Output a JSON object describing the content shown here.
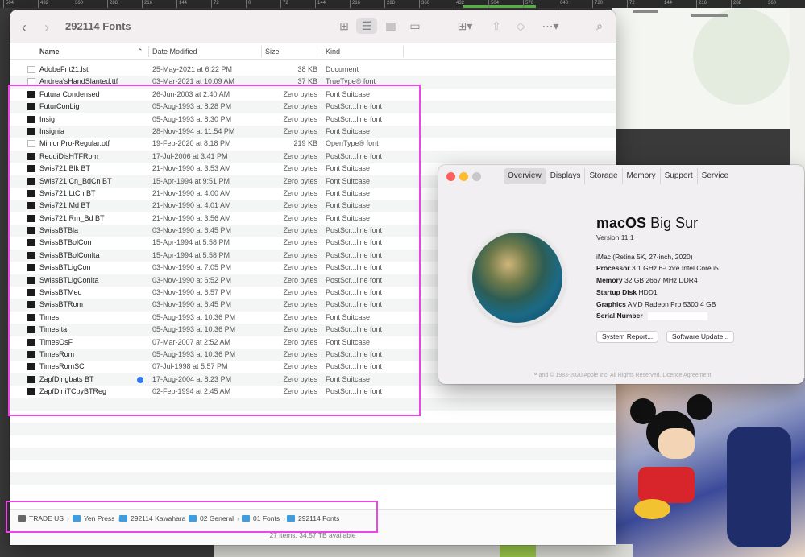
{
  "ruler": {
    "labels": [
      "504",
      "432",
      "360",
      "288",
      "216",
      "144",
      "72",
      "0",
      "72",
      "144",
      "216",
      "288",
      "360",
      "432",
      "504",
      "576",
      "648",
      "720",
      "72",
      "144",
      "216",
      "288",
      "360"
    ]
  },
  "finder": {
    "title": "292114 Fonts",
    "columns": {
      "name": "Name",
      "date": "Date Modified",
      "size": "Size",
      "kind": "Kind"
    },
    "files": [
      {
        "name": "AdobeFnt21.lst",
        "date": "25-May-2021 at 6:22 PM",
        "size": "38 KB",
        "kind": "Document",
        "icon": "document-icon"
      },
      {
        "name": "Andrea'sHandSlanted.ttf",
        "date": "03-Mar-2021 at 10:09 AM",
        "size": "37 KB",
        "kind": "TrueType® font",
        "icon": "font-file-icon"
      },
      {
        "name": "Futura Condensed",
        "date": "26-Jun-2003 at 2:40 AM",
        "size": "Zero bytes",
        "kind": "Font Suitcase",
        "icon": "font-suitcase-icon"
      },
      {
        "name": "FuturConLig",
        "date": "05-Aug-1993 at 8:28 PM",
        "size": "Zero bytes",
        "kind": "PostScr...line font",
        "icon": "postscript-font-icon"
      },
      {
        "name": "Insig",
        "date": "05-Aug-1993 at 8:30 PM",
        "size": "Zero bytes",
        "kind": "PostScr...line font",
        "icon": "postscript-font-icon"
      },
      {
        "name": "Insignia",
        "date": "28-Nov-1994 at 11:54 PM",
        "size": "Zero bytes",
        "kind": "Font Suitcase",
        "icon": "font-suitcase-icon"
      },
      {
        "name": "MinionPro-Regular.otf",
        "date": "19-Feb-2020 at 8:18 PM",
        "size": "219 KB",
        "kind": "OpenType® font",
        "icon": "font-file-icon"
      },
      {
        "name": "RequiDisHTFRom",
        "date": "17-Jul-2006 at 3:41 PM",
        "size": "Zero bytes",
        "kind": "PostScr...line font",
        "icon": "postscript-font-icon"
      },
      {
        "name": "Swis721 Blk BT",
        "date": "21-Nov-1990 at 3:53 AM",
        "size": "Zero bytes",
        "kind": "Font Suitcase",
        "icon": "font-suitcase-icon"
      },
      {
        "name": "Swis721 Cn_BdCn BT",
        "date": "15-Apr-1994 at 9:51 PM",
        "size": "Zero bytes",
        "kind": "Font Suitcase",
        "icon": "font-suitcase-icon"
      },
      {
        "name": "Swis721 LtCn BT",
        "date": "21-Nov-1990 at 4:00 AM",
        "size": "Zero bytes",
        "kind": "Font Suitcase",
        "icon": "font-suitcase-icon"
      },
      {
        "name": "Swis721 Md BT",
        "date": "21-Nov-1990 at 4:01 AM",
        "size": "Zero bytes",
        "kind": "Font Suitcase",
        "icon": "font-suitcase-icon"
      },
      {
        "name": "Swis721 Rm_Bd BT",
        "date": "21-Nov-1990 at 3:56 AM",
        "size": "Zero bytes",
        "kind": "Font Suitcase",
        "icon": "font-suitcase-icon"
      },
      {
        "name": "SwissBTBla",
        "date": "03-Nov-1990 at 6:45 PM",
        "size": "Zero bytes",
        "kind": "PostScr...line font",
        "icon": "postscript-font-icon"
      },
      {
        "name": "SwissBTBolCon",
        "date": "15-Apr-1994 at 5:58 PM",
        "size": "Zero bytes",
        "kind": "PostScr...line font",
        "icon": "postscript-font-icon"
      },
      {
        "name": "SwissBTBolConIta",
        "date": "15-Apr-1994 at 5:58 PM",
        "size": "Zero bytes",
        "kind": "PostScr...line font",
        "icon": "postscript-font-icon"
      },
      {
        "name": "SwissBTLigCon",
        "date": "03-Nov-1990 at 7:05 PM",
        "size": "Zero bytes",
        "kind": "PostScr...line font",
        "icon": "postscript-font-icon"
      },
      {
        "name": "SwissBTLigConIta",
        "date": "03-Nov-1990 at 6:52 PM",
        "size": "Zero bytes",
        "kind": "PostScr...line font",
        "icon": "postscript-font-icon"
      },
      {
        "name": "SwissBTMed",
        "date": "03-Nov-1990 at 6:57 PM",
        "size": "Zero bytes",
        "kind": "PostScr...line font",
        "icon": "postscript-font-icon"
      },
      {
        "name": "SwissBTRom",
        "date": "03-Nov-1990 at 6:45 PM",
        "size": "Zero bytes",
        "kind": "PostScr...line font",
        "icon": "postscript-font-icon"
      },
      {
        "name": "Times",
        "date": "05-Aug-1993 at 10:36 PM",
        "size": "Zero bytes",
        "kind": "Font Suitcase",
        "icon": "font-suitcase-icon"
      },
      {
        "name": "TimesIta",
        "date": "05-Aug-1993 at 10:36 PM",
        "size": "Zero bytes",
        "kind": "PostScr...line font",
        "icon": "postscript-font-icon"
      },
      {
        "name": "TimesOsF",
        "date": "07-Mar-2007 at 2:52 AM",
        "size": "Zero bytes",
        "kind": "Font Suitcase",
        "icon": "font-suitcase-icon"
      },
      {
        "name": "TimesRom",
        "date": "05-Aug-1993 at 10:36 PM",
        "size": "Zero bytes",
        "kind": "PostScr...line font",
        "icon": "postscript-font-icon"
      },
      {
        "name": "TimesRomSC",
        "date": "07-Jul-1998 at 5:57 PM",
        "size": "Zero bytes",
        "kind": "PostScr...line font",
        "icon": "postscript-font-icon"
      },
      {
        "name": "ZapfDingbats BT",
        "date": "17-Aug-2004 at 8:23 PM",
        "size": "Zero bytes",
        "kind": "Font Suitcase",
        "icon": "font-suitcase-icon",
        "tag_color": "#3478f6"
      },
      {
        "name": "ZapfDiniTCbyBTReg",
        "date": "02-Feb-1994 at 2:45 AM",
        "size": "Zero bytes",
        "kind": "PostScr...line font",
        "icon": "postscript-font-icon"
      }
    ],
    "path": [
      "TRADE US",
      "Yen Press",
      "292114 Kawahara",
      "02 General",
      "01 Fonts",
      "292114 Fonts"
    ],
    "status": "27 items, 34.57 TB available",
    "highlight_color": "#ee45e8"
  },
  "about": {
    "tabs": [
      "Overview",
      "Displays",
      "Storage",
      "Memory",
      "Support",
      "Service"
    ],
    "selected_tab": "Overview",
    "os_name_prefix": "macOS",
    "os_name_suffix": "Big Sur",
    "version": "Version 11.1",
    "model": "iMac (Retina 5K, 27-inch, 2020)",
    "specs": [
      {
        "label": "Processor",
        "value": "3.1 GHz 6-Core Intel Core i5"
      },
      {
        "label": "Memory",
        "value": "32 GB 2667 MHz DDR4"
      },
      {
        "label": "Startup Disk",
        "value": "HDD1"
      },
      {
        "label": "Graphics",
        "value": "AMD Radeon Pro 5300 4 GB"
      },
      {
        "label": "Serial Number",
        "value": ""
      }
    ],
    "buttons": [
      "System Report...",
      "Software Update..."
    ],
    "copyright": "™ and © 1983-2020 Apple Inc. All Rights Reserved. Licence Agreement",
    "traffic_lights": [
      "#fe5f57",
      "#febc2e",
      "#c8c8c8"
    ]
  }
}
